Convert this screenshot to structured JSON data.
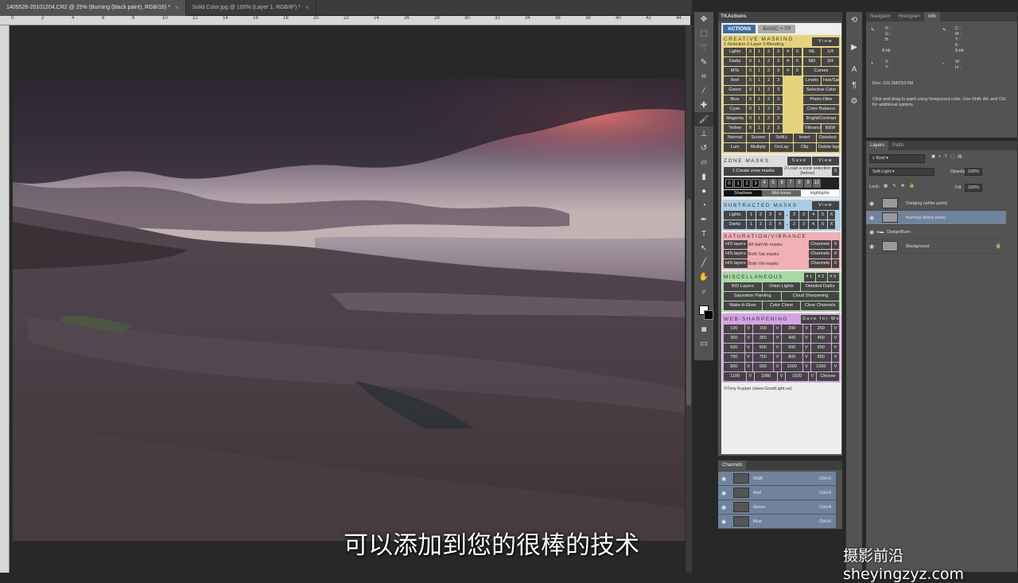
{
  "doc_tabs": [
    {
      "label": "1405526-20101204.CR2 @ 25% (Burning (black paint), RGB/16) *",
      "active": true
    },
    {
      "label": "Solid Color.jpg @ 100% (Layer 1, RGB/8*) *",
      "active": false
    }
  ],
  "ruler_ticks": [
    "0",
    "2",
    "4",
    "6",
    "8",
    "10",
    "12",
    "14",
    "16",
    "18",
    "20",
    "22",
    "24",
    "26",
    "28",
    "30",
    "32",
    "34",
    "36",
    "38",
    "40",
    "42",
    "44"
  ],
  "tk": {
    "title": "TKActions",
    "tabs": [
      "ACTIONS",
      "BASIC + TP"
    ],
    "creative": {
      "title": "CREATIVE MASKING",
      "sub": "1-Selection 2-Layer 3-Blending",
      "view": "View",
      "rows": [
        {
          "label": "Lights",
          "nums": [
            "1",
            "2",
            "3",
            "4",
            "5"
          ],
          "extra": [
            "ML",
            "1/4"
          ]
        },
        {
          "label": "Darks",
          "nums": [
            "1",
            "2",
            "3",
            "4",
            "5"
          ],
          "extra": [
            "MD",
            "3/4"
          ]
        },
        {
          "label": "MTs",
          "nums": [
            "1",
            "2",
            "3",
            "4",
            "5"
          ],
          "extra": [
            "Curves"
          ]
        },
        {
          "label": "Red",
          "nums": [
            "1",
            "2",
            "3"
          ],
          "extra": [
            "Levels",
            "Hue/Sat"
          ]
        },
        {
          "label": "Green",
          "nums": [
            "1",
            "2",
            "3"
          ],
          "extra": [
            "Selective Color"
          ]
        },
        {
          "label": "Blue",
          "nums": [
            "1",
            "2",
            "3"
          ],
          "extra": [
            "Photo Filter"
          ]
        },
        {
          "label": "Cyan",
          "nums": [
            "1",
            "2",
            "3"
          ],
          "extra": [
            "Color Balance"
          ]
        },
        {
          "label": "Magenta",
          "nums": [
            "1",
            "2",
            "3"
          ],
          "extra": [
            "Bright/Contrast"
          ]
        },
        {
          "label": "Yellow",
          "nums": [
            "1",
            "2",
            "3"
          ],
          "extra": [
            "Vibrance",
            "B&W"
          ]
        }
      ],
      "blend_rows": [
        [
          "Normal",
          "Screen",
          "SoftLt",
          "Invert",
          "Deselect"
        ],
        [
          "Lum",
          "Multiply",
          "OvrLay",
          "Clip",
          "Delete layer"
        ]
      ]
    },
    "zone": {
      "title": "ZONE MASKS",
      "save": "Save",
      "view": "View",
      "create": "1-Create zone masks",
      "load": "2-Load a zone selection (below)",
      "x": "X",
      "nums": [
        "0",
        "1",
        "2",
        "3",
        "4",
        "5",
        "6",
        "7",
        "8",
        "9",
        "10"
      ],
      "labels": [
        "Shadows",
        "Mid-tones",
        "Highlights"
      ]
    },
    "subtracted": {
      "title": "SUBTRACTED MASKS",
      "view": "View",
      "rows": [
        {
          "label": "Lights"
        },
        {
          "label": "Darks"
        }
      ],
      "left": [
        "1",
        "2",
        "3",
        "4"
      ],
      "right": [
        "2",
        "3",
        "4",
        "5"
      ],
      "dash": "–",
      "x": "X"
    },
    "saturation": {
      "title": "SATURATION/VIBRANCE",
      "rows": [
        {
          "btn": "H/S layers",
          "text": "All Sat/Vib masks",
          "ch": "Channels"
        },
        {
          "btn": "H/S layers",
          "text": "Both Sat masks",
          "ch": "Channels"
        },
        {
          "btn": "H/S layers",
          "text": "Both Vib masks",
          "ch": "Channels"
        }
      ],
      "x": "X"
    },
    "misc": {
      "title": "MISCELLANEOUS",
      "nums": [
        "#1",
        "#2",
        "#3"
      ],
      "rows": [
        [
          "B/D Layers",
          "Orton Lights",
          "Detailed Darks"
        ],
        [
          "Saturation Painting",
          "Cloud Sharpening"
        ],
        [
          "Make-It-Glow",
          "Color Clone",
          "Clear Channels"
        ]
      ]
    },
    "web": {
      "title": "WEB-SHARPENING",
      "save": "Save for Web",
      "v": "V",
      "rows": [
        [
          "100",
          "150",
          "200",
          "250"
        ],
        [
          "300",
          "350",
          "400",
          "450"
        ],
        [
          "500",
          "550",
          "600",
          "650"
        ],
        [
          "700",
          "750",
          "800",
          "850"
        ],
        [
          "900",
          "950",
          "1000",
          "1050"
        ],
        [
          "1100",
          "1080",
          "1920",
          "Choose"
        ]
      ]
    },
    "credit": "©Tony Kuyper (www.GoodLight.us)"
  },
  "info": {
    "tabs": [
      "Navigator",
      "Histogram",
      "Info"
    ],
    "rgb": "R :\nG :\nB :",
    "cmyk": "C :\nM :\nY :\nK :",
    "bit1": "8-bit",
    "bit2": "8-bit",
    "xy": "X :\nY :",
    "wh": "W :\nH :",
    "doc": "Doc: 103.3M/233.0M",
    "hint": "Click and drag to paint using foreground color.  Use Shift, Alt, and Ctrl for additional options."
  },
  "layers": {
    "tabs": [
      "Layers",
      "Paths"
    ],
    "kind": "Kind",
    "blend": "Soft Light",
    "opacity_label": "Opacity:",
    "opacity": "100%",
    "lock_label": "Lock:",
    "fill_label": "Fill:",
    "fill": "100%",
    "items": [
      {
        "name": "Dodging (white paint)",
        "sel": false
      },
      {
        "name": "Burning (black paint)",
        "sel": true
      },
      {
        "name": "Dodge/Burn",
        "sel": false
      },
      {
        "name": "Background",
        "sel": false
      }
    ]
  },
  "channels": {
    "title": "Channels",
    "items": [
      {
        "name": "RGB",
        "sc": "Ctrl+2"
      },
      {
        "name": "Red",
        "sc": "Ctrl+3"
      },
      {
        "name": "Green",
        "sc": "Ctrl+4"
      },
      {
        "name": "Blue",
        "sc": "Ctrl+5"
      }
    ]
  },
  "subtitle": "可以添加到您的很棒的技术",
  "watermark": "摄影前沿 sheyingzyz.com"
}
